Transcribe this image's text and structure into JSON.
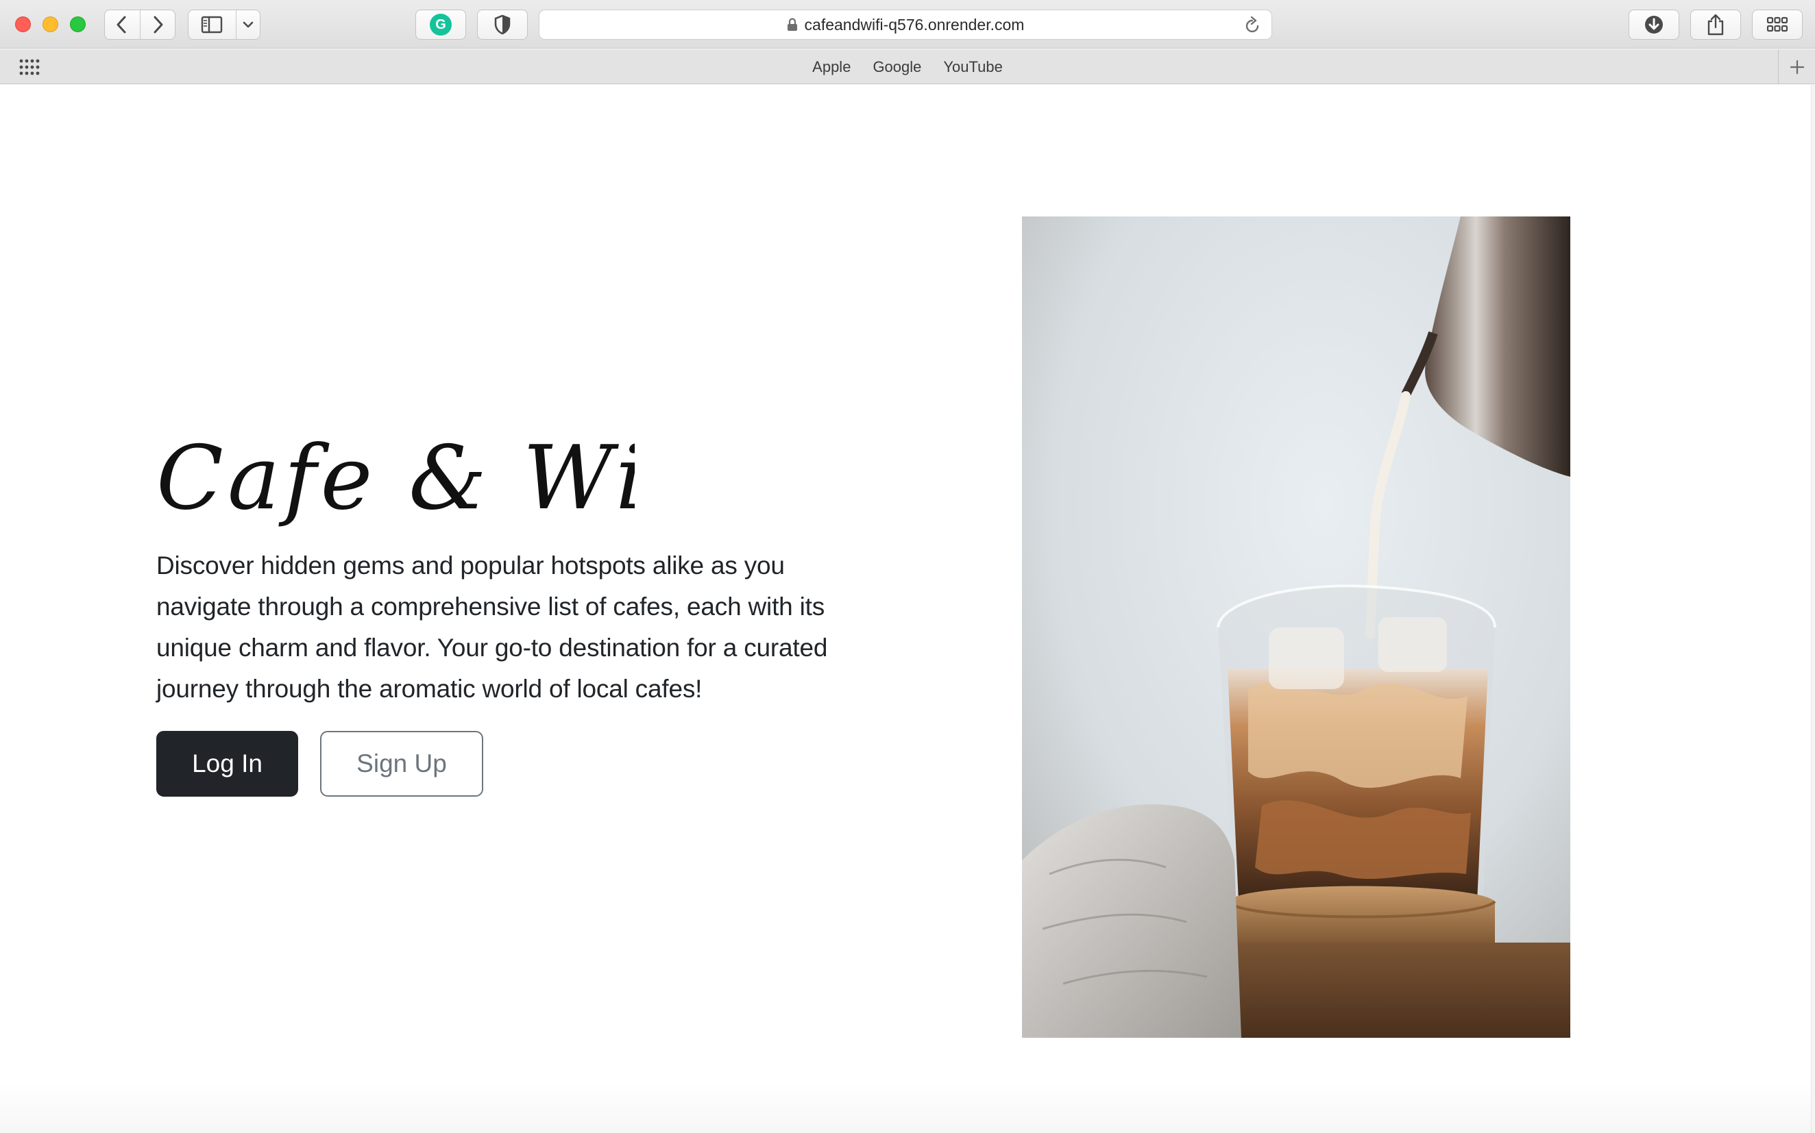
{
  "browser": {
    "url": "cafeandwifi-q576.onrender.com",
    "bookmarks": [
      "Apple",
      "Google",
      "YouTube"
    ],
    "icons": {
      "back": "chevron-left-icon",
      "forward": "chevron-right-icon",
      "sidebar": "sidebar-icon",
      "grammarly": "grammarly-icon",
      "privacy": "shield-icon",
      "lock": "lock-icon",
      "reload": "reload-icon",
      "download": "download-icon",
      "share": "share-icon",
      "tabs": "tab-overview-icon"
    },
    "grammarly_letter": "G"
  },
  "hero": {
    "title": "Cafe & WiFi",
    "description": "Discover hidden gems and popular hotspots alike as you navigate through a comprehensive list of cafes, each with its unique charm and flavor. Your go-to destination for a curated journey through the aromatic world of local cafes!",
    "login_label": "Log In",
    "signup_label": "Sign Up"
  },
  "colors": {
    "primary_button": "#212529",
    "secondary_outline": "#6c757d",
    "text": "#212529"
  }
}
